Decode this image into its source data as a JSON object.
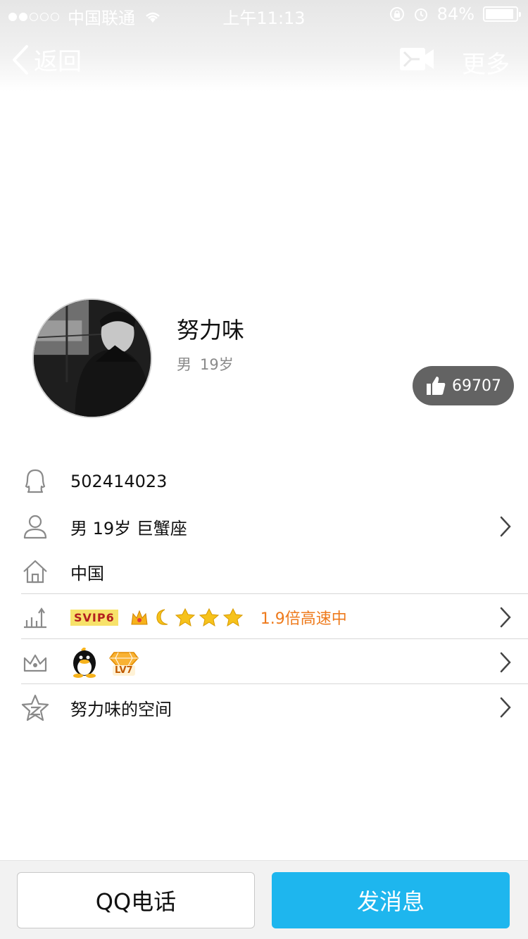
{
  "status_bar": {
    "carrier": "中国联通",
    "time": "上午11:13",
    "battery": "84%",
    "battery_level": 0.84
  },
  "nav": {
    "back_label": "返回",
    "more_label": "更多"
  },
  "profile": {
    "nickname": "努力味",
    "gender": "男",
    "age": "19岁",
    "likes": "69707"
  },
  "info": {
    "qq_number": "502414023",
    "details": "男 19岁 巨蟹座",
    "location": "中国",
    "vip_badge": "SVIP6",
    "vip_speed": "1.9倍高速中",
    "qq_level_badge": "LV7",
    "space": "努力味的空间"
  },
  "actions": {
    "call_label": "QQ电话",
    "message_label": "发消息"
  },
  "colors": {
    "accent": "#1eb6ee",
    "vip_text": "#ee7a1c",
    "like_bg": "#636363"
  }
}
